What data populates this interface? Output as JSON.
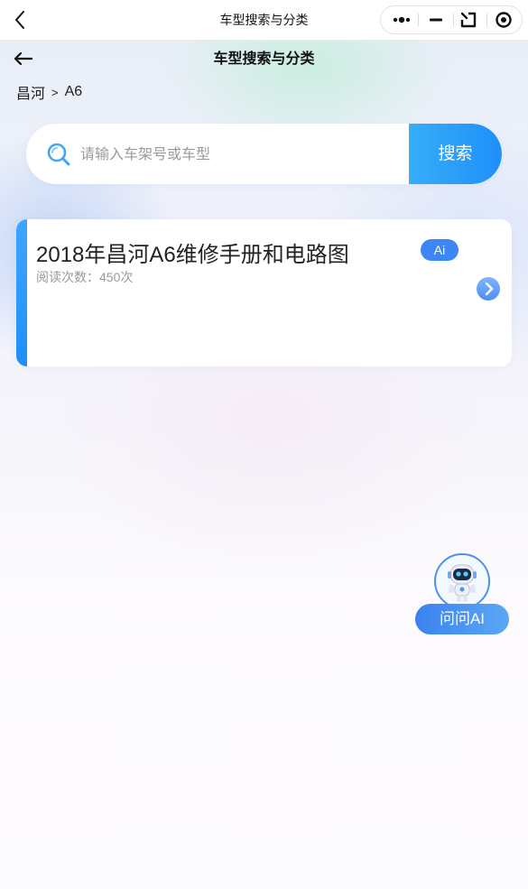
{
  "topbar": {
    "title": "车型搜索与分类"
  },
  "nav": {
    "title": "车型搜索与分类"
  },
  "breadcrumb": {
    "brand": "昌河",
    "separator": ">",
    "model": "A6"
  },
  "search": {
    "placeholder": "请输入车架号或车型",
    "value": "",
    "button_label": "搜索"
  },
  "results": [
    {
      "title": "2018年昌河A6维修手册和电路图",
      "reads": "阅读次数：450次",
      "badge": "Ai"
    }
  ],
  "assistant": {
    "label": "问问AI"
  },
  "colors": {
    "accent": "#1f8ff9",
    "badge": "#3d86f5",
    "assistant": "#3b82f0"
  }
}
